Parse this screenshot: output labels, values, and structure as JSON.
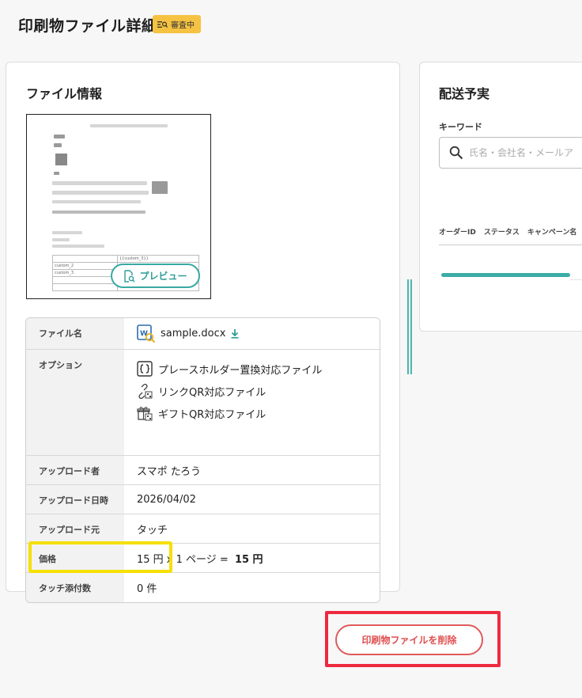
{
  "page": {
    "title": "印刷物ファイル詳細",
    "status_badge": "審査中"
  },
  "file_info": {
    "title": "ファイル情報",
    "preview": {
      "button_label": "プレビュー",
      "doc_rows": [
        "custom_2",
        "custom_3"
      ],
      "doc_cell": "{{custom_3}}"
    },
    "rows": {
      "filename_label": "ファイル名",
      "filename_value": "sample.docx",
      "option_label": "オプション",
      "options": [
        "プレースホルダー置換対応ファイル",
        "リンクQR対応ファイル",
        "ギフトQR対応ファイル"
      ],
      "uploader_label": "アップロード者",
      "uploader_value": "スマポ たろう",
      "upload_date_label": "アップロード日時",
      "upload_date_value": "2026/04/02",
      "upload_source_label": "アップロード元",
      "upload_source_value": "タッチ",
      "price_label": "価格",
      "price_value": "15 円 x 1 ページ = ",
      "price_total": "15 円",
      "touch_count_label": "タッチ添付数",
      "touch_count_value": "0 件"
    }
  },
  "delivery": {
    "title": "配送予実",
    "keyword_label": "キーワード",
    "search_placeholder": "氏名・会社名・メールア",
    "columns": [
      "オーダーID",
      "ステータス",
      "キャンペーン名"
    ]
  },
  "actions": {
    "delete_label": "印刷物ファイルを削除"
  },
  "colors": {
    "accent_teal": "#3aa9a4",
    "badge_yellow": "#f5c242",
    "danger_red": "#e05050",
    "highlight_yellow": "#f5e000",
    "highlight_red": "#ee2a40"
  }
}
